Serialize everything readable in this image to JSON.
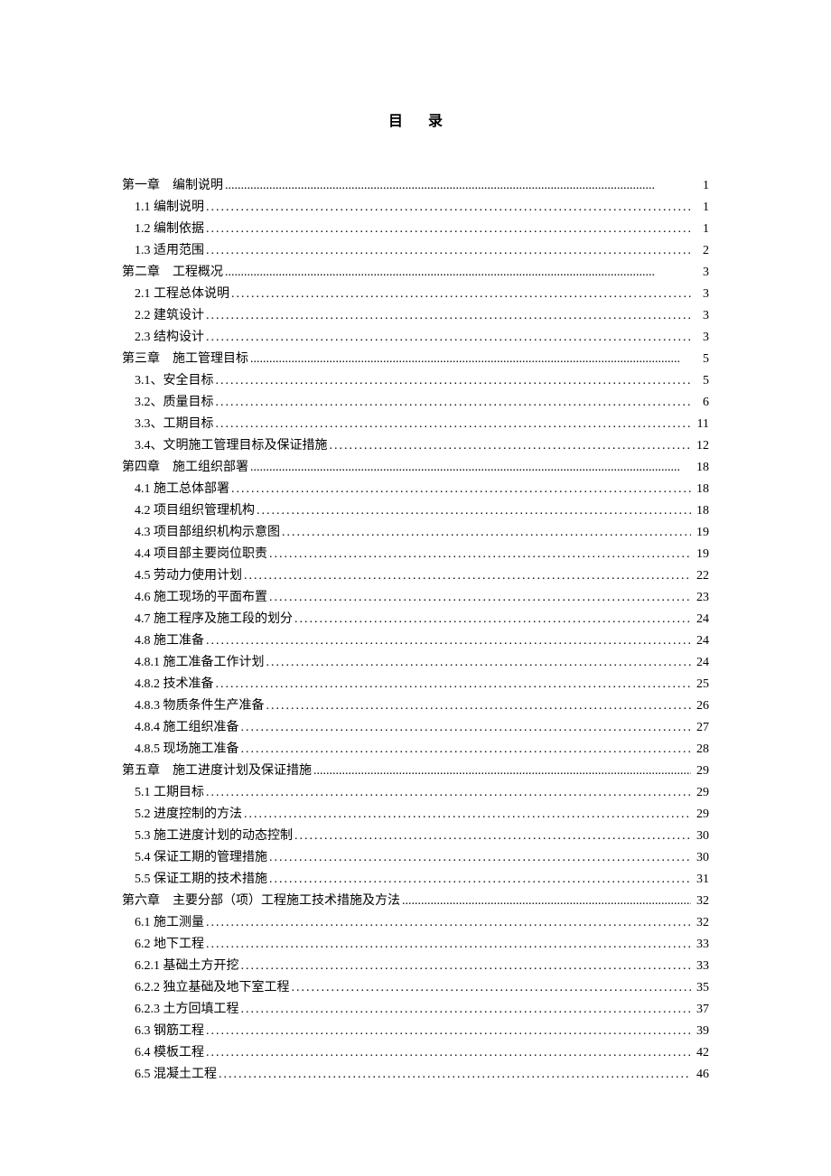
{
  "title": "目录",
  "entries": [
    {
      "level": 0,
      "label": "第一章　编制说明",
      "page": "1",
      "leader": "thin"
    },
    {
      "level": 1,
      "label": "1.1 编制说明",
      "page": "1",
      "leader": "dots"
    },
    {
      "level": 1,
      "label": "1.2 编制依据",
      "page": "1",
      "leader": "dots"
    },
    {
      "level": 1,
      "label": "1.3 适用范围",
      "page": "2",
      "leader": "dots"
    },
    {
      "level": 0,
      "label": "第二章　工程概况",
      "page": "3",
      "leader": "thin"
    },
    {
      "level": 1,
      "label": "2.1 工程总体说明",
      "page": "3",
      "leader": "dots"
    },
    {
      "level": 1,
      "label": "2.2 建筑设计",
      "page": "3",
      "leader": "dots"
    },
    {
      "level": 1,
      "label": "2.3 结构设计",
      "page": "3",
      "leader": "dots"
    },
    {
      "level": 0,
      "label": "第三章　施工管理目标",
      "page": "5",
      "leader": "thin"
    },
    {
      "level": 1,
      "label": "3.1、安全目标",
      "page": "5",
      "leader": "dots"
    },
    {
      "level": 1,
      "label": "3.2、质量目标",
      "page": "6",
      "leader": "dots"
    },
    {
      "level": 1,
      "label": "3.3、工期目标",
      "page": "11",
      "leader": "dots"
    },
    {
      "level": 1,
      "label": "3.4、文明施工管理目标及保证措施",
      "page": "12",
      "leader": "dots"
    },
    {
      "level": 0,
      "label": "第四章　施工组织部署",
      "page": "18",
      "leader": "thin"
    },
    {
      "level": 1,
      "label": "4.1 施工总体部署",
      "page": "18",
      "leader": "dots"
    },
    {
      "level": 1,
      "label": "4.2 项目组织管理机构",
      "page": "18",
      "leader": "dots"
    },
    {
      "level": 1,
      "label": "4.3 项目部组织机构示意图",
      "page": "19",
      "leader": "dots"
    },
    {
      "level": 1,
      "label": "4.4 项目部主要岗位职责",
      "page": "19",
      "leader": "dots"
    },
    {
      "level": 1,
      "label": "4.5 劳动力使用计划",
      "page": "22",
      "leader": "dots"
    },
    {
      "level": 1,
      "label": "4.6 施工现场的平面布置",
      "page": "23",
      "leader": "dots"
    },
    {
      "level": 1,
      "label": "4.7 施工程序及施工段的划分",
      "page": "24",
      "leader": "dots"
    },
    {
      "level": 1,
      "label": "4.8 施工准备",
      "page": "24",
      "leader": "dots"
    },
    {
      "level": 1,
      "label": "4.8.1 施工准备工作计划",
      "page": "24",
      "leader": "dots"
    },
    {
      "level": 1,
      "label": "4.8.2 技术准备",
      "page": "25",
      "leader": "dots"
    },
    {
      "level": 1,
      "label": "4.8.3 物质条件生产准备",
      "page": "26",
      "leader": "dots"
    },
    {
      "level": 1,
      "label": "4.8.4 施工组织准备",
      "page": "27",
      "leader": "dots"
    },
    {
      "level": 1,
      "label": "4.8.5 现场施工准备",
      "page": "28",
      "leader": "dots"
    },
    {
      "level": 0,
      "label": "第五章　施工进度计划及保证措施",
      "page": "29",
      "leader": "thin"
    },
    {
      "level": 1,
      "label": "5.1 工期目标",
      "page": "29",
      "leader": "dots"
    },
    {
      "level": 1,
      "label": "5.2 进度控制的方法",
      "page": "29",
      "leader": "dots"
    },
    {
      "level": 1,
      "label": "5.3 施工进度计划的动态控制",
      "page": "30",
      "leader": "dots"
    },
    {
      "level": 1,
      "label": "5.4 保证工期的管理措施",
      "page": "30",
      "leader": "dots"
    },
    {
      "level": 1,
      "label": "5.5 保证工期的技术措施",
      "page": "31",
      "leader": "dots"
    },
    {
      "level": 0,
      "label": "第六章　主要分部（项）工程施工技术措施及方法",
      "page": "32",
      "leader": "thin"
    },
    {
      "level": 1,
      "label": "6.1 施工测量",
      "page": "32",
      "leader": "dots"
    },
    {
      "level": 1,
      "label": "6.2 地下工程",
      "page": "33",
      "leader": "dots"
    },
    {
      "level": 1,
      "label": "6.2.1 基础土方开挖",
      "page": "33",
      "leader": "dots"
    },
    {
      "level": 1,
      "label": "6.2.2 独立基础及地下室工程",
      "page": "35",
      "leader": "dots"
    },
    {
      "level": 1,
      "label": "6.2.3 土方回填工程",
      "page": "37",
      "leader": "dots"
    },
    {
      "level": 1,
      "label": "6.3 钢筋工程",
      "page": "39",
      "leader": "dots"
    },
    {
      "level": 1,
      "label": "6.4 模板工程",
      "page": "42",
      "leader": "dots"
    },
    {
      "level": 1,
      "label": "6.5 混凝土工程",
      "page": "46",
      "leader": "dots"
    }
  ]
}
